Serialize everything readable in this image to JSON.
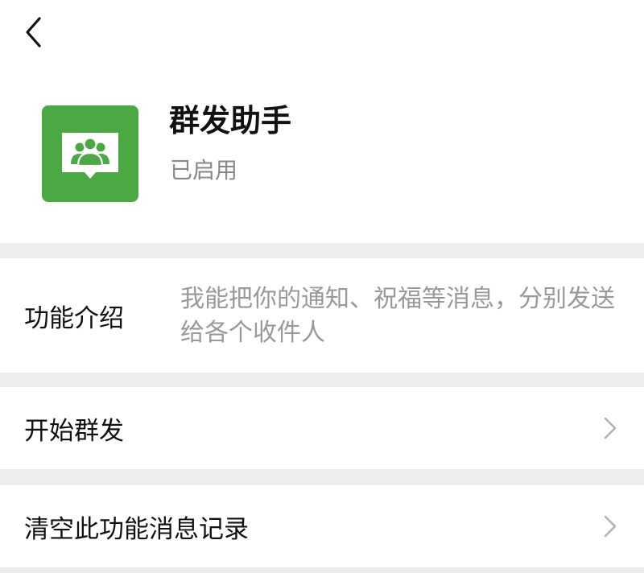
{
  "header": {
    "back_icon": "chevron-left-icon"
  },
  "profile": {
    "icon": "group-broadcast-icon",
    "icon_color": "#4ba944",
    "name": "群发助手",
    "status": "已启用"
  },
  "intro": {
    "label": "功能介绍",
    "description": "我能把你的通知、祝福等消息，分别发送给各个收件人"
  },
  "actions": [
    {
      "label": "开始群发",
      "icon": "chevron-right-icon"
    },
    {
      "label": "清空此功能消息记录",
      "icon": "chevron-right-icon"
    }
  ],
  "colors": {
    "background": "#ededed",
    "panel": "#ffffff",
    "primary_text": "#111111",
    "secondary_text": "#888888",
    "chevron": "#b2b2b2"
  }
}
